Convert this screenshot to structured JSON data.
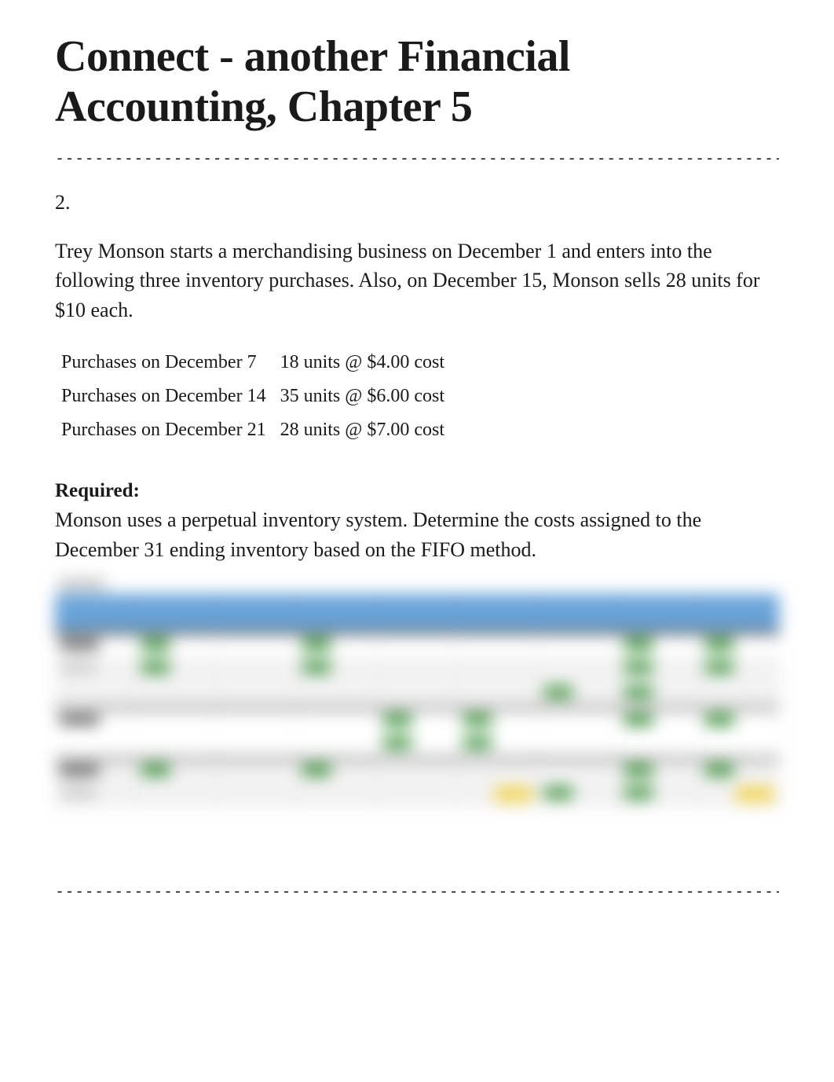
{
  "title": "Connect - another Financial Accounting, Chapter 5",
  "divider": "--------------------------------------------------------------------------------------",
  "question_number": "2.",
  "intro_paragraph": "Trey Monson starts a merchandising business on December 1 and enters into the following three inventory purchases. Also, on December 15, Monson sells 28 units for $10 each.",
  "purchases": [
    {
      "label": "Purchases on December 7",
      "detail": "18 units @ $4.00 cost"
    },
    {
      "label": "Purchases on December 14",
      "detail": "35 units @ $6.00 cost"
    },
    {
      "label": "Purchases on December 21",
      "detail": "28 units @ $7.00 cost"
    }
  ],
  "required_label": "Required:",
  "required_text": "Monson uses a perpetual inventory system. Determine the costs assigned to the December 31 ending inventory based on the FIFO method."
}
